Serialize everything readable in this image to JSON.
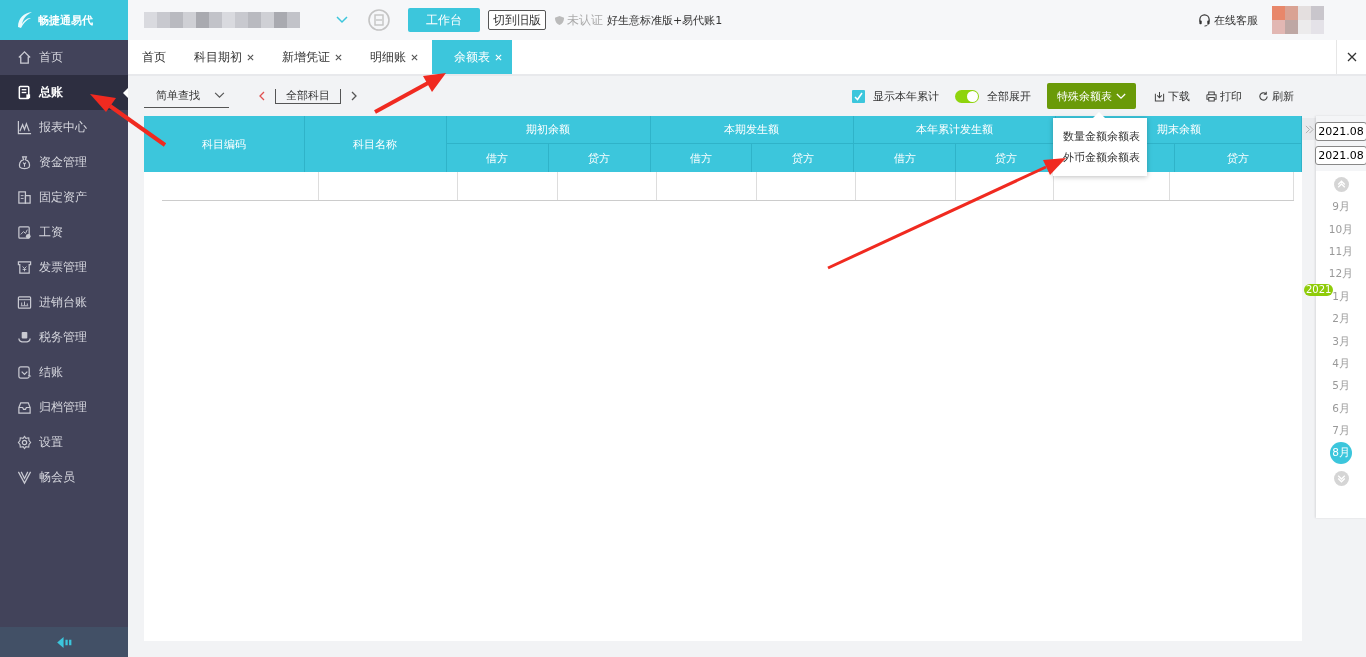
{
  "app": {
    "logo": "畅捷通易代",
    "workbench_button": "工作台",
    "switch_button": "切到旧版",
    "cert_status": "未认证",
    "edition": "好生意标准版+易代账1",
    "support": "在线客服"
  },
  "sidebar": {
    "items": [
      {
        "label": "首页",
        "selected": false
      },
      {
        "label": "总账",
        "selected": true
      },
      {
        "label": "报表中心",
        "selected": false
      },
      {
        "label": "资金管理",
        "selected": false
      },
      {
        "label": "固定资产",
        "selected": false
      },
      {
        "label": "工资",
        "selected": false
      },
      {
        "label": "发票管理",
        "selected": false
      },
      {
        "label": "进销台账",
        "selected": false
      },
      {
        "label": "税务管理",
        "selected": false
      },
      {
        "label": "结账",
        "selected": false
      },
      {
        "label": "归档管理",
        "selected": false
      },
      {
        "label": "设置",
        "selected": false
      },
      {
        "label": "畅会员",
        "selected": false
      }
    ]
  },
  "tabs": [
    {
      "label": "首页",
      "closable": false,
      "selected": false
    },
    {
      "label": "科目期初",
      "closable": true,
      "selected": false
    },
    {
      "label": "新增凭证",
      "closable": true,
      "selected": false
    },
    {
      "label": "明细账",
      "closable": true,
      "selected": false
    },
    {
      "label": "余额表",
      "closable": true,
      "selected": true
    }
  ],
  "toolbar": {
    "query_mode": "简单查找",
    "subject_filter": "全部科目",
    "show_year_total": {
      "label": "显示本年累计",
      "checked": true
    },
    "expand_all": {
      "label": "全部展开",
      "on": true
    },
    "special_button": "特殊余额表",
    "actions": [
      {
        "kind": "download",
        "label": "下载"
      },
      {
        "kind": "print",
        "label": "打印"
      },
      {
        "kind": "refresh",
        "label": "刷新"
      }
    ]
  },
  "menu": [
    "数量金额余额表",
    "外币金额余额表"
  ],
  "table": {
    "columns": [
      {
        "label": "科目编码"
      },
      {
        "label": "科目名称"
      },
      {
        "label": "期初余额",
        "children": [
          "借方",
          "贷方"
        ]
      },
      {
        "label": "本期发生额",
        "children": [
          "借方",
          "贷方"
        ]
      },
      {
        "label": "本年累计发生额",
        "children": [
          "借方",
          "贷方"
        ]
      },
      {
        "label": "期末余额",
        "children": [
          "贷方"
        ]
      }
    ]
  },
  "period": {
    "start": "2021.08",
    "end": "2021.08",
    "year_badge": "2021",
    "months": [
      {
        "label": "9月",
        "selected": false
      },
      {
        "label": "10月",
        "selected": false
      },
      {
        "label": "11月",
        "selected": false
      },
      {
        "label": "12月",
        "selected": false
      },
      {
        "label": "1月",
        "selected": false
      },
      {
        "label": "2月",
        "selected": false
      },
      {
        "label": "3月",
        "selected": false
      },
      {
        "label": "4月",
        "selected": false
      },
      {
        "label": "5月",
        "selected": false
      },
      {
        "label": "6月",
        "selected": false
      },
      {
        "label": "7月",
        "selected": false
      },
      {
        "label": "8月",
        "selected": true
      }
    ]
  }
}
